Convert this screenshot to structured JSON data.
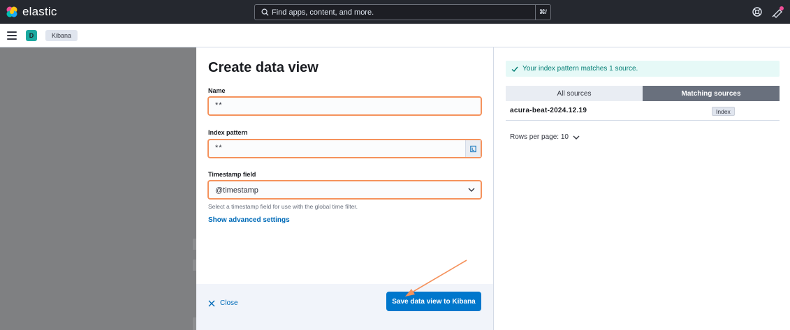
{
  "header": {
    "brand": "elastic",
    "search_placeholder": "Find apps, content, and more.",
    "search_shortcut": "⌘/"
  },
  "subbar": {
    "space_initial": "D",
    "breadcrumb": "Kibana"
  },
  "form": {
    "title": "Create data view",
    "name_label": "Name",
    "name_value": "**",
    "index_label": "Index pattern",
    "index_value": "**",
    "timestamp_label": "Timestamp field",
    "timestamp_value": "@timestamp",
    "timestamp_help": "Select a timestamp field for use with the global time filter.",
    "advanced_link": "Show advanced settings",
    "close_label": "Close",
    "save_label": "Save data view to Kibana"
  },
  "preview": {
    "callout": "Your index pattern matches 1 source.",
    "tabs": [
      "All sources",
      "Matching sources"
    ],
    "rows": [
      {
        "name": "acura-beat-2024.12.19",
        "badge": "Index"
      }
    ],
    "rows_per_page": "Rows per page: 10"
  },
  "colors": {
    "accent": "#0077cc",
    "highlight": "#f5925c",
    "success": "#017d73"
  }
}
